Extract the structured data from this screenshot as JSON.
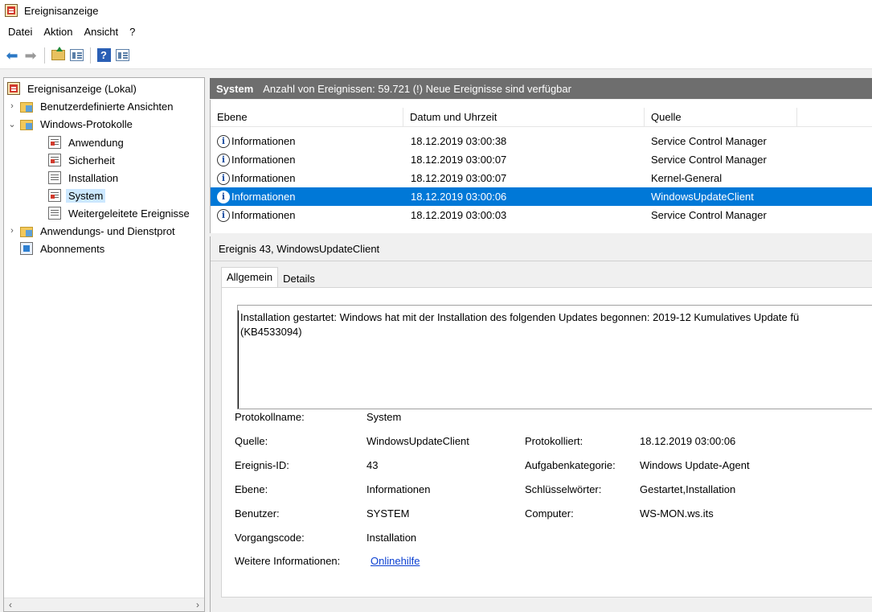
{
  "window": {
    "title": "Ereignisanzeige"
  },
  "menu": [
    "Datei",
    "Aktion",
    "Ansicht",
    "?"
  ],
  "toolbar": {
    "back_icon": "arrow-left-icon",
    "forward_icon": "arrow-right-icon",
    "up_icon": "folder-up-icon",
    "panel_icon": "show-hide-console-tree-icon",
    "help_icon": "help-icon",
    "actions_icon": "show-hide-action-pane-icon",
    "help_glyph": "?"
  },
  "tree": {
    "items": [
      {
        "label": "Ereignisanzeige (Lokal)",
        "icon": "event-viewer-icon"
      },
      {
        "label": "Benutzerdefinierte Ansichten",
        "icon": "folder-icon",
        "chevron": "›"
      },
      {
        "label": "Windows-Protokolle",
        "icon": "folder-icon",
        "chevron": "⌄"
      },
      {
        "label": "Anwendung",
        "icon": "log-icon"
      },
      {
        "label": "Sicherheit",
        "icon": "log-icon"
      },
      {
        "label": "Installation",
        "icon": "log-icon"
      },
      {
        "label": "System",
        "icon": "log-icon"
      },
      {
        "label": "Weitergeleitete Ereignisse",
        "icon": "log-icon"
      },
      {
        "label": "Anwendungs- und Dienstprot",
        "icon": "folder-icon",
        "chevron": "›"
      },
      {
        "label": "Abonnements",
        "icon": "subscriptions-icon"
      }
    ],
    "scroll_left": "‹",
    "scroll_right": "›"
  },
  "events": {
    "log_name": "System",
    "summary": "Anzahl von Ereignissen: 59.721 (!) Neue Ereignisse sind verfügbar",
    "columns": [
      "Ebene",
      "Datum und Uhrzeit",
      "Quelle"
    ],
    "rows": [
      {
        "level": "Informationen",
        "datetime": "18.12.2019 03:00:38",
        "source": "Service Control Manager"
      },
      {
        "level": "Informationen",
        "datetime": "18.12.2019 03:00:07",
        "source": "Service Control Manager"
      },
      {
        "level": "Informationen",
        "datetime": "18.12.2019 03:00:07",
        "source": "Kernel-General"
      },
      {
        "level": "Informationen",
        "datetime": "18.12.2019 03:00:06",
        "source": "WindowsUpdateClient",
        "selected": true
      },
      {
        "level": "Informationen",
        "datetime": "18.12.2019 03:00:03",
        "source": "Service Control Manager"
      }
    ]
  },
  "detail": {
    "title": "Ereignis 43, WindowsUpdateClient",
    "tabs": [
      "Allgemein",
      "Details"
    ],
    "description_line1": "Installation gestartet: Windows hat mit der Installation des folgenden Updates begonnen: 2019-12 Kumulatives Update fü",
    "description_line2": "(KB4533094)",
    "labels": {
      "protokollname": "Protokollname:",
      "quelle": "Quelle:",
      "ereignis_id": "Ereignis-ID:",
      "ebene": "Ebene:",
      "benutzer": "Benutzer:",
      "vorgangscode": "Vorgangscode:",
      "weitere": "Weitere Informationen:",
      "protokolliert": "Protokolliert:",
      "aufgabenkategorie": "Aufgabenkategorie:",
      "schluesselwoerter": "Schlüsselwörter:",
      "computer": "Computer:"
    },
    "values": {
      "protokollname": "System",
      "quelle": "WindowsUpdateClient",
      "ereignis_id": "43",
      "ebene": "Informationen",
      "benutzer": "SYSTEM",
      "vorgangscode": "Installation",
      "weitere": "Onlinehilfe",
      "protokolliert": "18.12.2019 03:00:06",
      "aufgabenkategorie": "Windows Update-Agent",
      "schluesselwoerter": "Gestartet,Installation",
      "computer": "WS-MON.ws.its"
    }
  }
}
